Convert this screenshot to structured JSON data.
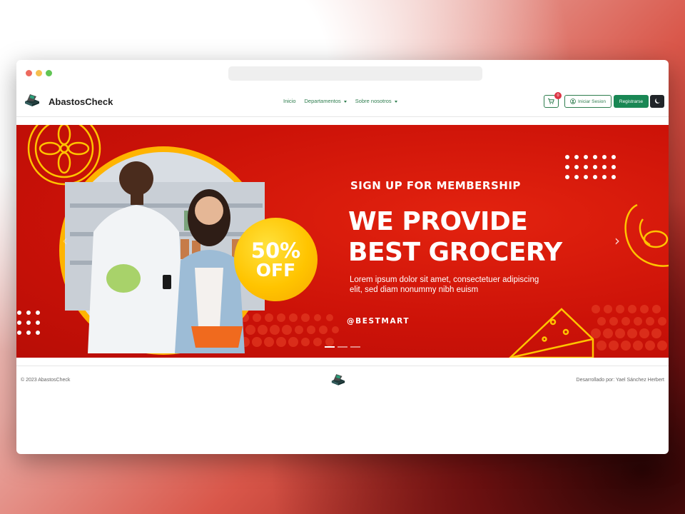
{
  "brand": {
    "name": "AbastosCheck",
    "logo_icon": "laptop-cart-logo-icon"
  },
  "nav": {
    "items": [
      {
        "label": "Inicio"
      },
      {
        "label": "Departamentos"
      },
      {
        "label": "Sobre nosotros"
      }
    ]
  },
  "toolbar": {
    "cart_count": "0",
    "login_label": "Iniciar Sesion",
    "register_label": "Registrarse",
    "theme_icon": "moon-icon"
  },
  "banner": {
    "subtitle": "SIGN UP FOR MEMBERSHIP",
    "headline_1": "WE PROVIDE",
    "headline_2": "BEST GROCERY",
    "lorem_1": "Lorem ipsum dolor sit amet, consectetuer adipiscing",
    "lorem_2": "elit, sed diam nonummy nibh euism",
    "offer_pct": "50%",
    "offer_off": "OFF",
    "handle": "@BESTMART",
    "prev_glyph": "‹",
    "next_glyph": "›",
    "slide_count": 3,
    "active_slide": 1,
    "colors": {
      "background": "#cc1208",
      "accent": "#ffc400"
    }
  },
  "footer": {
    "copyright": "© 2023 AbastosCheck",
    "credit": "Desarrollado por: Yael Sánchez Herbert"
  },
  "colors": {
    "primary": "#198754",
    "outline": "#2e7d4e",
    "badge": "#dc3545",
    "dark": "#212529"
  }
}
